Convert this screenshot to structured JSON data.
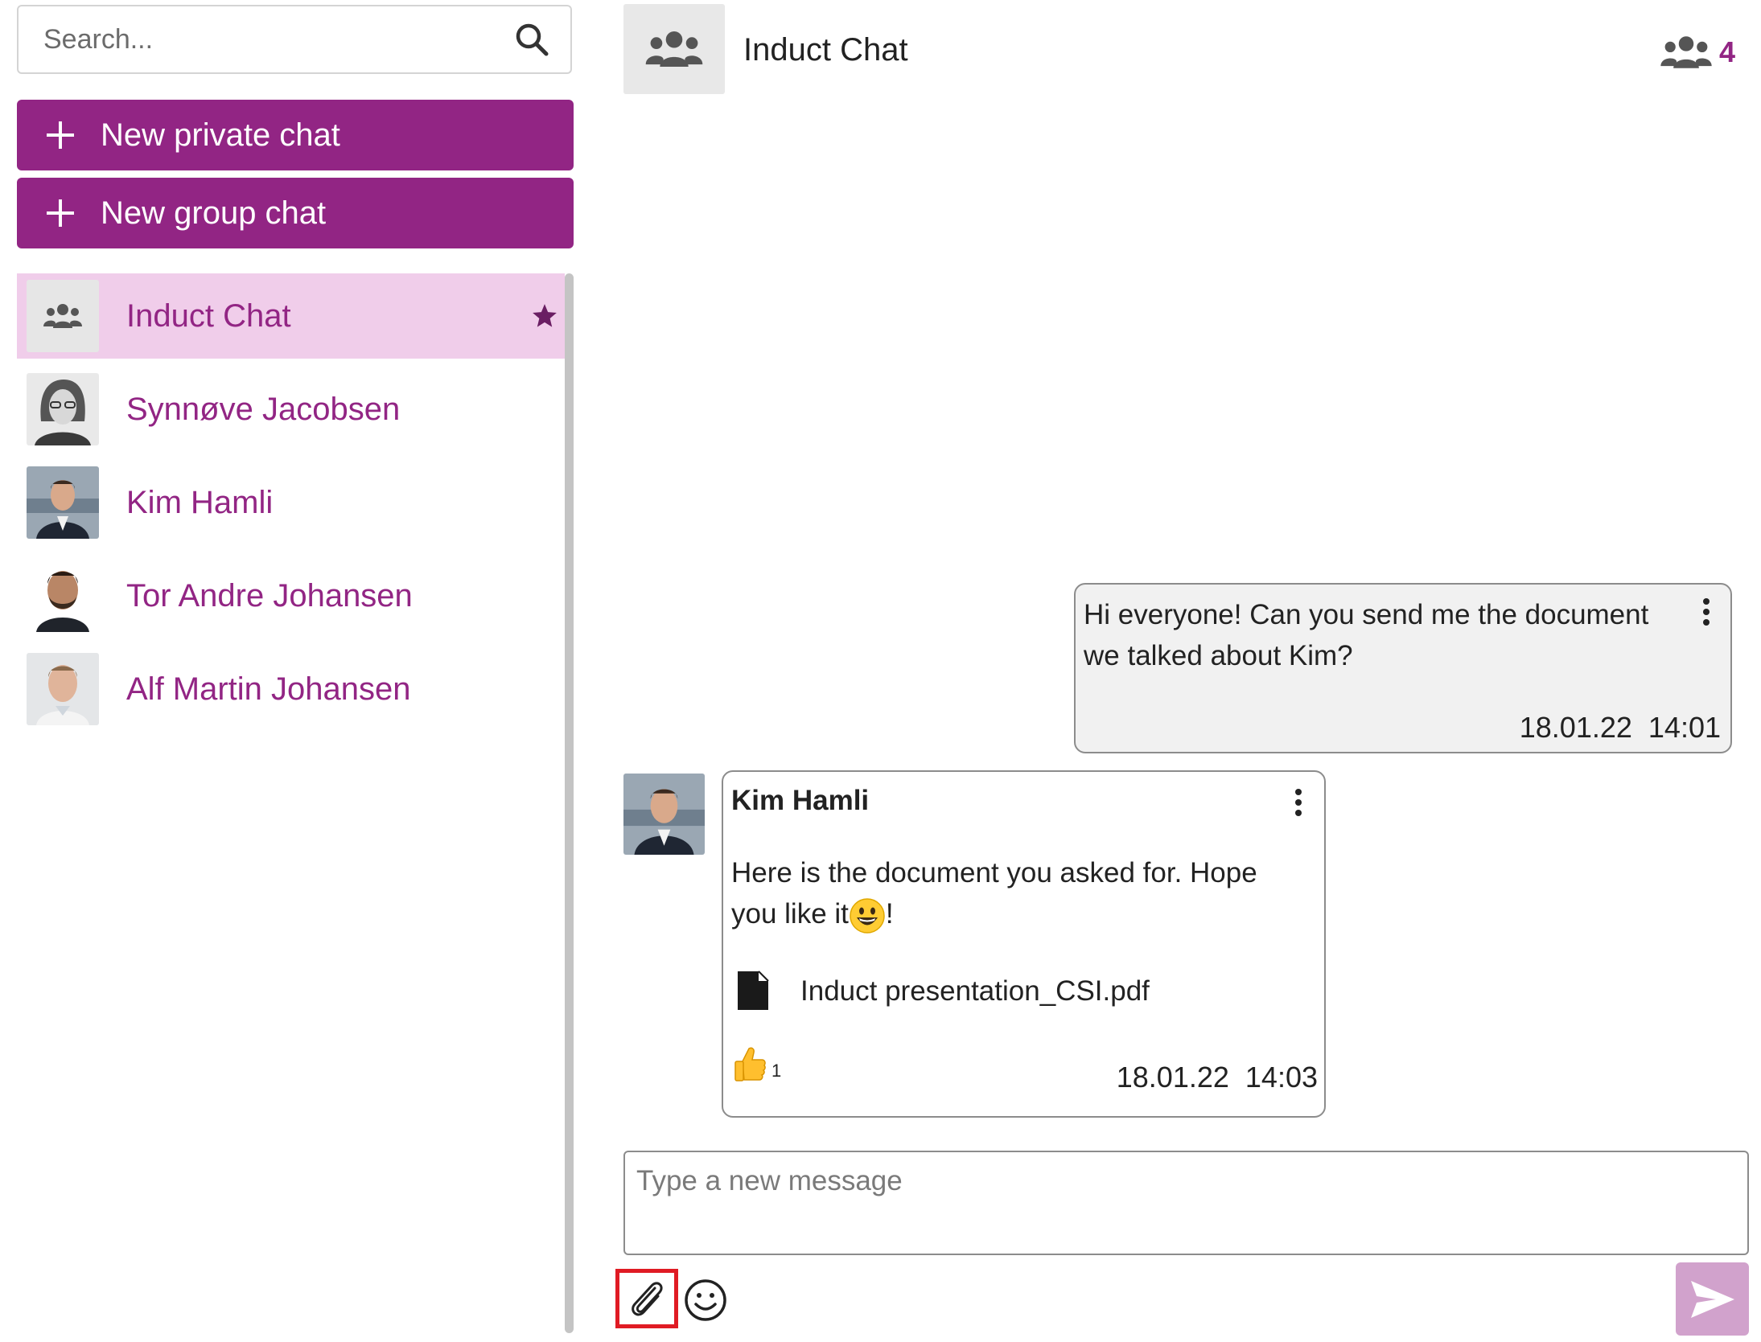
{
  "sidebar": {
    "search": {
      "placeholder": "Search...",
      "value": ""
    },
    "new_private_chat_label": "New private chat",
    "new_group_chat_label": "New group chat",
    "chats": [
      {
        "name": "Induct Chat",
        "type": "group",
        "active": true,
        "starred": true
      },
      {
        "name": "Synnøve Jacobsen",
        "type": "person"
      },
      {
        "name": "Kim Hamli",
        "type": "person"
      },
      {
        "name": "Tor Andre Johansen",
        "type": "person"
      },
      {
        "name": "Alf Martin Johansen",
        "type": "person"
      }
    ]
  },
  "header": {
    "title": "Induct Chat",
    "member_count": "4",
    "icons": {
      "avatar": "users-group-icon",
      "members": "users-group-icon"
    }
  },
  "messages": [
    {
      "own": true,
      "text": "Hi everyone! Can you send me the document we talked about Kim?",
      "date": "18.01.22",
      "time": "14:01"
    },
    {
      "own": false,
      "sender": "Kim Hamli",
      "text_before_emoji": "Here is the document you asked for. Hope you like it",
      "text_after_emoji": "!",
      "emoji": "grinning-face",
      "attachment": {
        "file_name": "Induct presentation_CSI.pdf",
        "icon": "file-icon"
      },
      "reaction": {
        "emoji": "thumbs-up",
        "count": "1"
      },
      "date": "18.01.22",
      "time": "14:03"
    }
  ],
  "composer": {
    "placeholder": "Type a new message",
    "value": ""
  },
  "colors": {
    "accent": "#922584",
    "active_chat_bg": "#f0cdea",
    "send_button": "#d1a2cc",
    "highlight_box": "#e01b24"
  }
}
